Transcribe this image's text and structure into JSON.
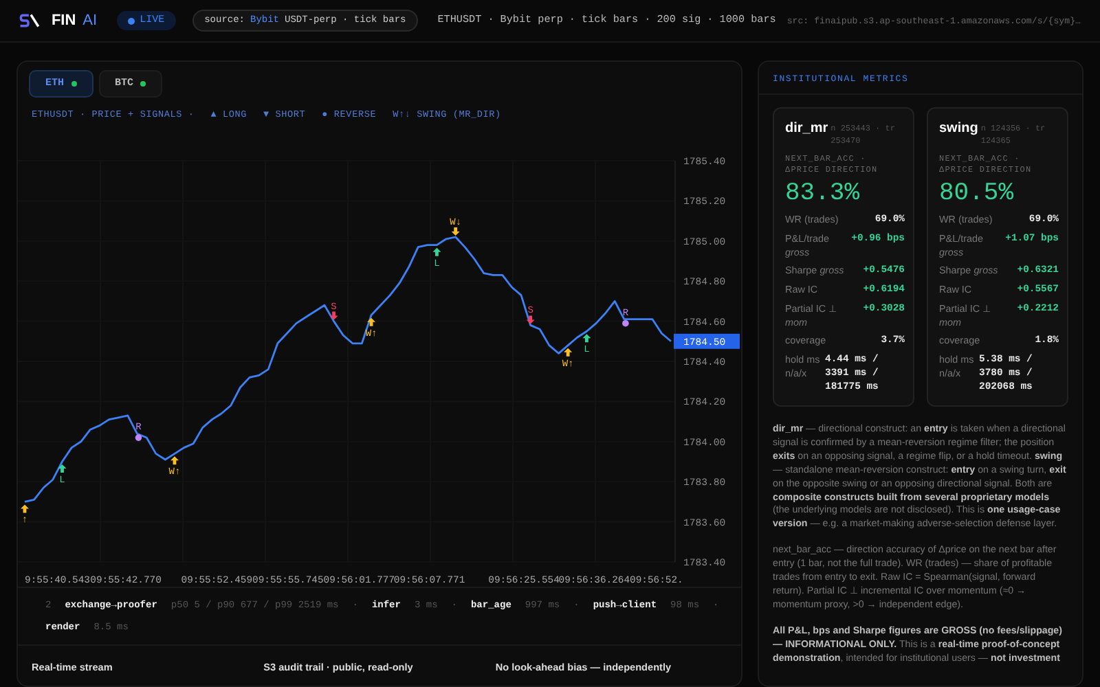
{
  "top_bar": {
    "brand": "FIN",
    "brand_accent": "AI",
    "live_label": "LIVE",
    "source_prefix": "source:",
    "source_venue": "Bybit",
    "source_detail": "USDT-perp · tick bars",
    "summary": "ETHUSDT · Bybit perp · tick bars · 200 sig · 1000 bars",
    "src": "src: finaipub.s3.ap-southeast-1.amazonaws.com/s/{sym}…"
  },
  "chart_panel": {
    "tabs": [
      {
        "label": "ETH",
        "selected": true
      },
      {
        "label": "BTC",
        "selected": false
      }
    ],
    "heading": "ETHUSDT · PRICE + SIGNALS  ·",
    "legend": [
      {
        "label": "▲ LONG"
      },
      {
        "label": "▼ SHORT"
      },
      {
        "label": "● REVERSE"
      },
      {
        "label": "W↑↓ SWING (MR_DIR)"
      }
    ],
    "last_price": "1784.50",
    "chart_data": {
      "type": "line",
      "grid": true,
      "ylim": [
        1783.4,
        1785.4
      ],
      "yticks": [
        {
          "value": 1785.4,
          "label": "1785.40"
        },
        {
          "value": 1785.2,
          "label": "1785.20"
        },
        {
          "value": 1785.0,
          "label": "1785.00"
        },
        {
          "value": 1784.8,
          "label": "1784.80"
        },
        {
          "value": 1784.6,
          "label": "1784.60"
        },
        {
          "value": 1784.4,
          "label": "1784.40"
        },
        {
          "value": 1784.2,
          "label": "1784.20"
        },
        {
          "value": 1784.0,
          "label": "1784.00"
        },
        {
          "value": 1783.8,
          "label": "1783.80"
        },
        {
          "value": 1783.6,
          "label": "1783.60"
        },
        {
          "value": 1783.4,
          "label": "1783.40"
        }
      ],
      "series": [
        {
          "color": "#3b82f6",
          "values": [
            1783.7,
            1783.71,
            1783.77,
            1783.81,
            1783.9,
            1783.97,
            1784.0,
            1784.06,
            1784.08,
            1784.11,
            1784.12,
            1784.13,
            1784.04,
            1784.02,
            1783.94,
            1783.91,
            1783.94,
            1783.97,
            1783.99,
            1784.07,
            1784.11,
            1784.14,
            1784.18,
            1784.27,
            1784.32,
            1784.33,
            1784.36,
            1784.49,
            1784.54,
            1784.59,
            1784.62,
            1784.65,
            1784.68,
            1784.6,
            1784.53,
            1784.49,
            1784.49,
            1784.63,
            1784.68,
            1784.73,
            1784.79,
            1784.87,
            1784.97,
            1784.98,
            1784.98,
            1785.01,
            1785.02,
            1784.97,
            1784.91,
            1784.84,
            1784.83,
            1784.83,
            1784.77,
            1784.73,
            1784.58,
            1784.56,
            1784.48,
            1784.44,
            1784.48,
            1784.52,
            1784.55,
            1784.59,
            1784.64,
            1784.7,
            1784.61,
            1784.61,
            1784.61,
            1784.61,
            1784.54,
            1784.5
          ]
        }
      ]
    },
    "time_labels": [
      "9:55:40.543",
      "09:55:42.770",
      "09:55:52.459",
      "09:55:55.745",
      "09:56:01.777",
      "09:56:07.771",
      "09:56:25.554",
      "09:56:36.264",
      "09:56:52."
    ],
    "signals": [
      {
        "kind": "swing_up",
        "label": "↑"
      },
      {
        "kind": "long",
        "label": "L"
      },
      {
        "kind": "reverse",
        "label": "R"
      },
      {
        "kind": "swing_up",
        "label": "W↑"
      },
      {
        "kind": "short",
        "label": "S"
      },
      {
        "kind": "swing_up",
        "label": "W↑"
      },
      {
        "kind": "long",
        "label": "L"
      },
      {
        "kind": "swing_down",
        "label": "W↓"
      },
      {
        "kind": "short",
        "label": "S"
      },
      {
        "kind": "swing_up",
        "label": "W↑"
      },
      {
        "kind": "long",
        "label": "L"
      },
      {
        "kind": "reverse",
        "label": "R"
      }
    ],
    "latency": {
      "count": "2",
      "items": [
        {
          "name": "exchange→proofer",
          "value": "p50 5 / p90 677 / p99 2519 ms",
          "separator": "·"
        },
        {
          "name": "infer",
          "value": "3 ms",
          "separator": "·"
        },
        {
          "name": "bar_age",
          "value": "997 ms",
          "separator": "·"
        },
        {
          "name": "push→client",
          "value": "98 ms",
          "separator": "·"
        },
        {
          "name": "render",
          "value": "8.5 ms"
        }
      ]
    },
    "footer": [
      "Real-time stream",
      "S3 audit trail · public, read-only",
      "No look-ahead bias — independently"
    ]
  },
  "metrics": {
    "title": "INSTITUTIONAL METRICS",
    "cards": [
      {
        "name": "dir_mr",
        "meta": "n 253443 · tr 253470",
        "subtitle": "NEXT_BAR_ACC · ΔPRICE DIRECTION",
        "headline": "83.3%",
        "rows": [
          {
            "label": "WR (trades)",
            "value": "69.0%",
            "positive": false
          },
          {
            "label": "P&L/trade *gross*",
            "value": "+0.96 bps",
            "positive": true
          },
          {
            "label": "Sharpe *gross*",
            "value": "+0.5476",
            "positive": true
          },
          {
            "label": "Raw IC",
            "value": "+0.6194",
            "positive": true
          },
          {
            "label": "Partial IC ⊥ *mom*",
            "value": "+0.3028",
            "positive": true
          },
          {
            "label": "coverage",
            "value": "3.7%",
            "positive": false
          },
          {
            "label": "hold ms n/a/x",
            "value": "4.44 ms / 3391 ms / 181775 ms",
            "positive": false
          }
        ]
      },
      {
        "name": "swing",
        "meta": "n 124356 · tr 124365",
        "subtitle": "NEXT_BAR_ACC · ΔPRICE DIRECTION",
        "headline": "80.5%",
        "rows": [
          {
            "label": "WR (trades)",
            "value": "69.0%",
            "positive": false
          },
          {
            "label": "P&L/trade *gross*",
            "value": "+1.07 bps",
            "positive": true
          },
          {
            "label": "Sharpe *gross*",
            "value": "+0.6321",
            "positive": true
          },
          {
            "label": "Raw IC",
            "value": "+0.5567",
            "positive": true
          },
          {
            "label": "Partial IC ⊥ *mom*",
            "value": "+0.2212",
            "positive": true
          },
          {
            "label": "coverage",
            "value": "1.8%",
            "positive": false
          },
          {
            "label": "hold ms n/a/x",
            "value": "5.38 ms / 3780 ms / 202068 ms",
            "positive": false
          }
        ]
      }
    ],
    "notes": [
      "**dir_mr** — directional construct: an **entry** is taken when a directional signal is confirmed by a mean-reversion regime filter; the position **exits** on an opposing signal, a regime flip, or a hold timeout. **swing** — standalone mean-reversion construct: **entry** on a swing turn, **exit** on the opposite swing or an opposing directional signal. Both are **composite constructs built from several proprietary models** (the underlying models are not disclosed). This is **one usage-case version** — e.g. a market-making adverse-selection defense layer.",
      "next_bar_acc — direction accuracy of Δprice on the next bar after entry (1 bar, not the full trade). WR (trades) — share of profitable trades from entry to exit. Raw IC = Spearman(signal, forward return). Partial IC ⊥ incremental IC over momentum (≈0 → momentum proxy, >0 → independent edge).",
      "**All P&L, bps and Sharpe figures are GROSS (no fees/slippage) — INFORMATIONAL ONLY.** This is a **real-time proof-of-concept demonstration**, intended for institutional users — **not investment**"
    ]
  }
}
